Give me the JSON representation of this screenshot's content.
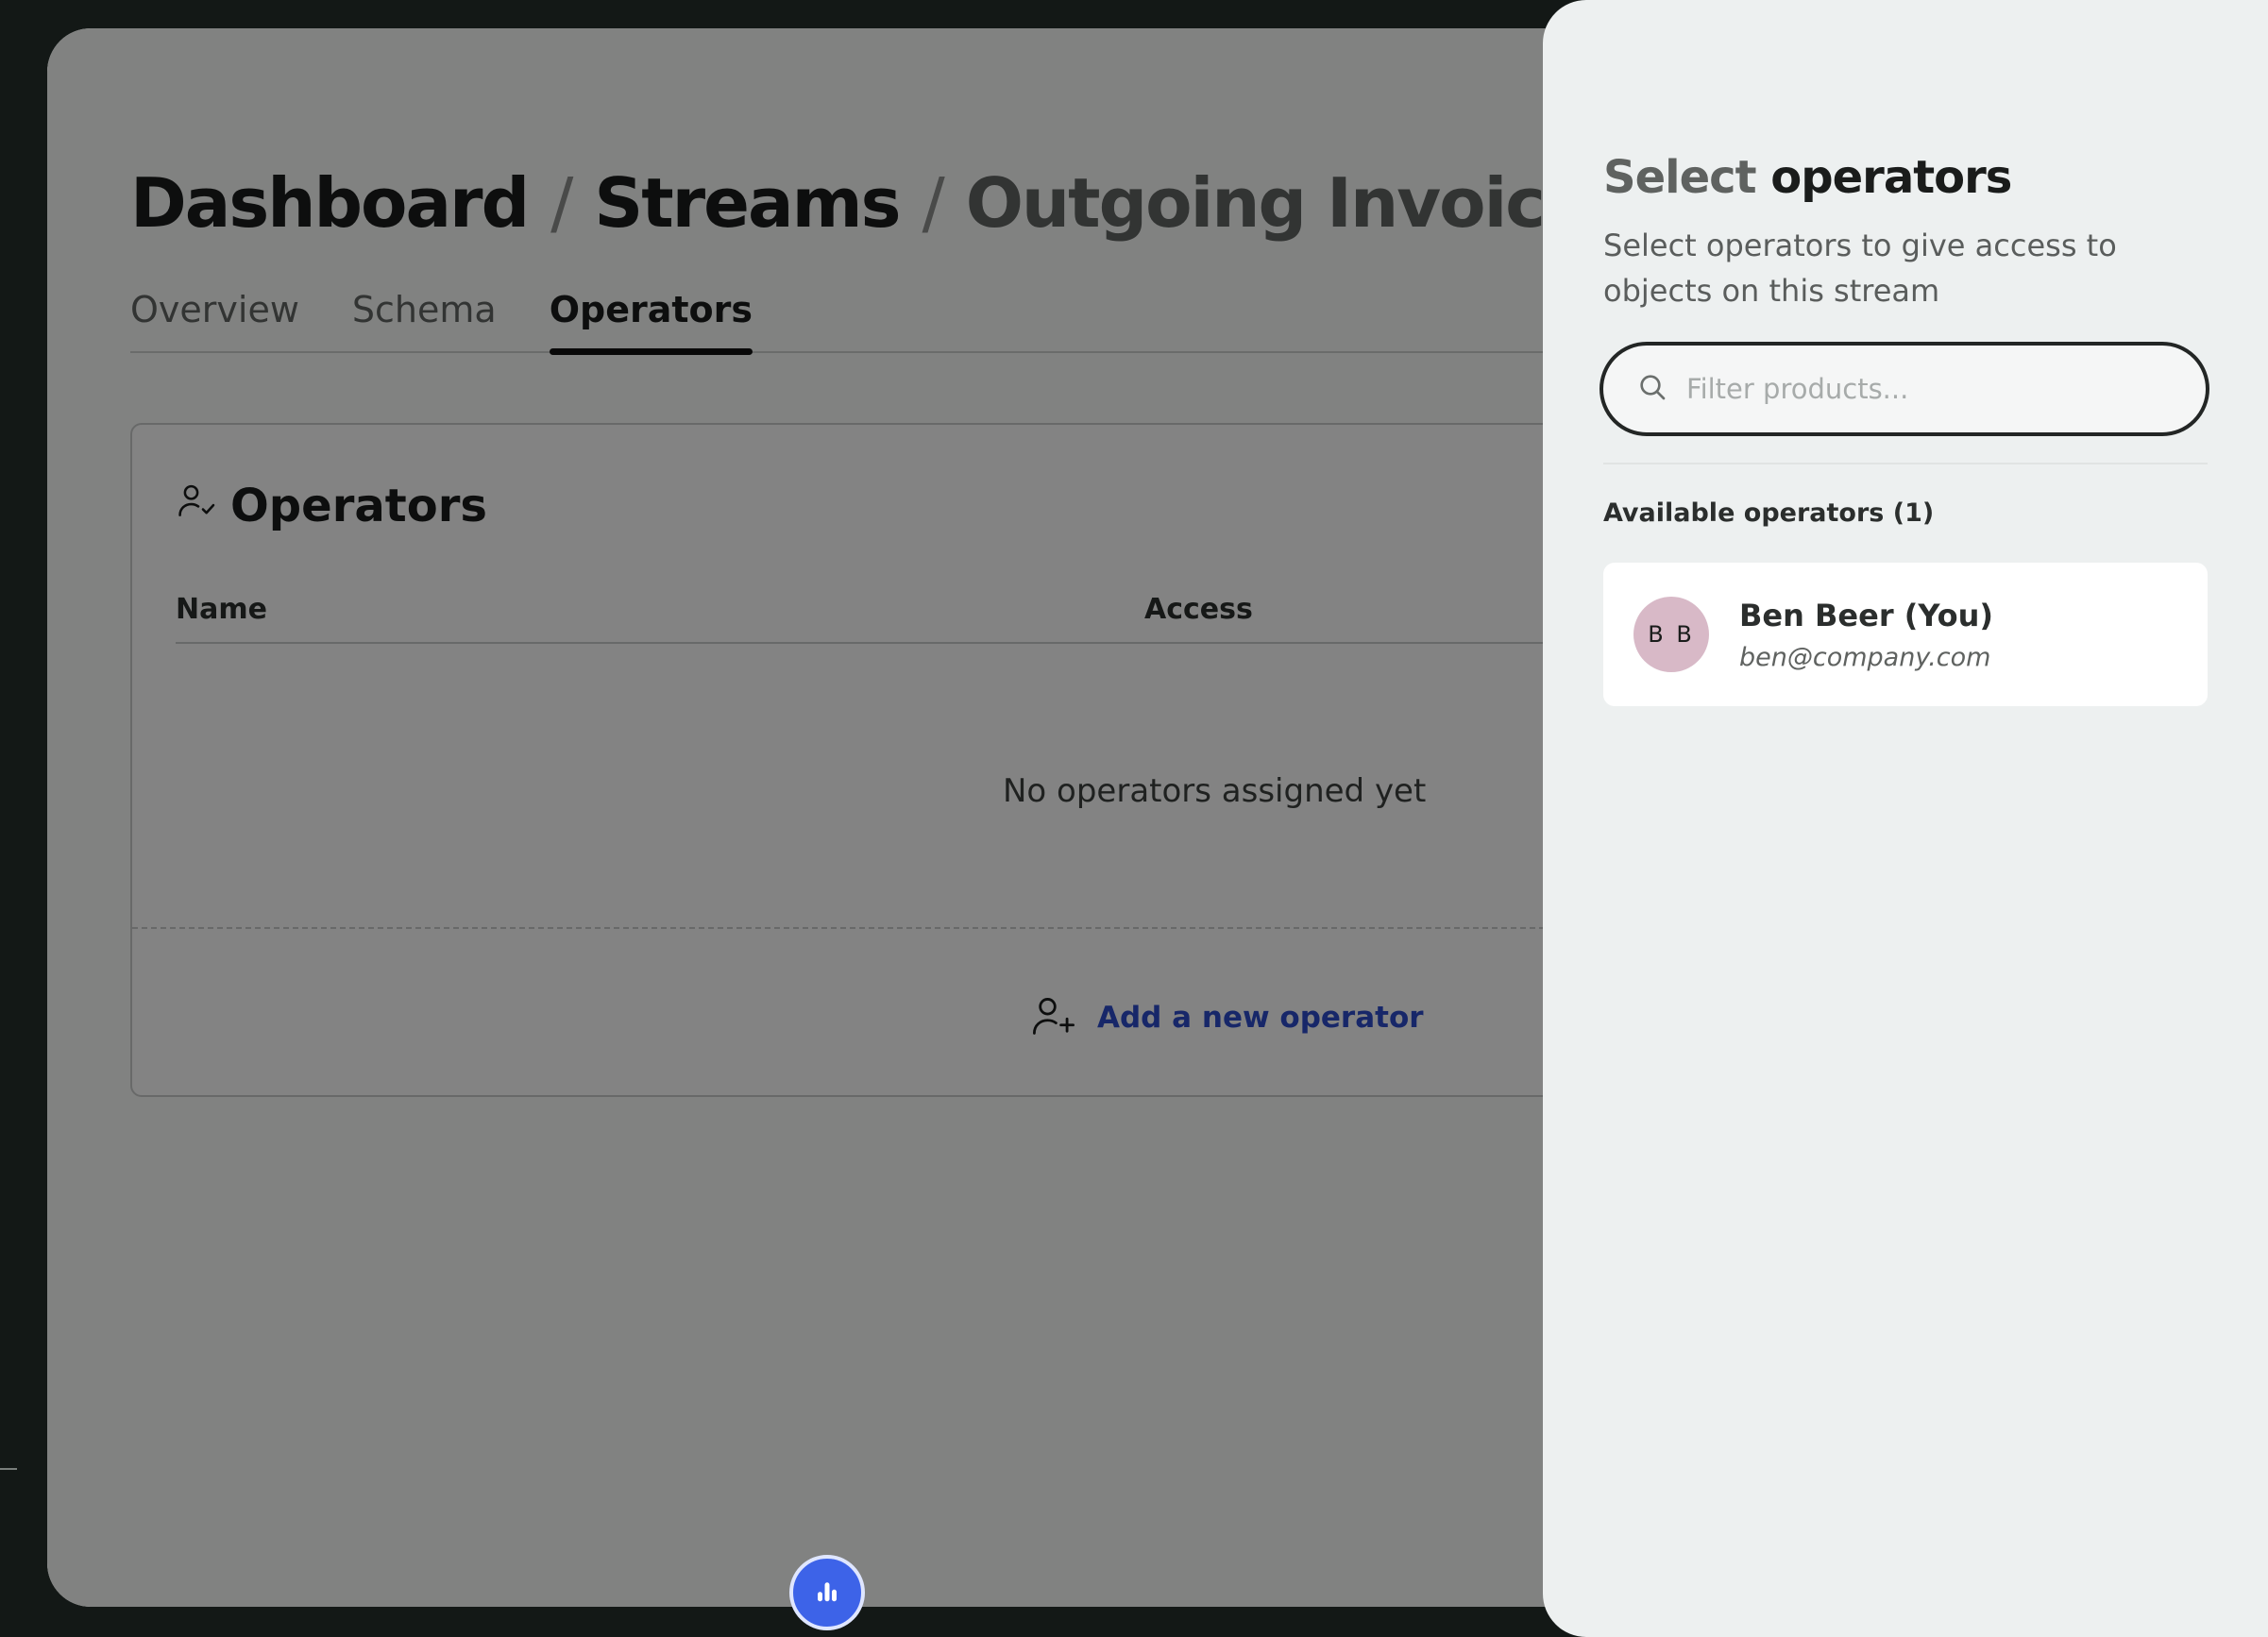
{
  "breadcrumb": {
    "items": [
      "Dashboard",
      "Streams",
      "Outgoing Invoices"
    ],
    "separator": "/"
  },
  "tabs": [
    {
      "label": "Overview",
      "active": false
    },
    {
      "label": "Schema",
      "active": false
    },
    {
      "label": "Operators",
      "active": true
    }
  ],
  "operators_card": {
    "title": "Operators",
    "columns": [
      "Name",
      "Access"
    ],
    "empty_text": "No operators assigned yet",
    "add_label": "Add a new operator"
  },
  "panel": {
    "title_muted": "Select",
    "title_strong": "operators",
    "description": "Select operators to give access to objects on this stream",
    "search_placeholder": "Filter products...",
    "search_value": "",
    "section_label": "Available operators (1)",
    "operators": [
      {
        "initials": "B B",
        "name": "Ben Beer (You)",
        "email": "ben@company.com"
      }
    ]
  },
  "icons": {
    "card_title": "user-check-icon",
    "add": "user-plus-icon",
    "search": "search-icon",
    "fab": "bar-chart-icon"
  },
  "colors": {
    "accent": "#2d4bc7",
    "fab": "#3d63e8",
    "avatar": "#d8b9c7"
  }
}
